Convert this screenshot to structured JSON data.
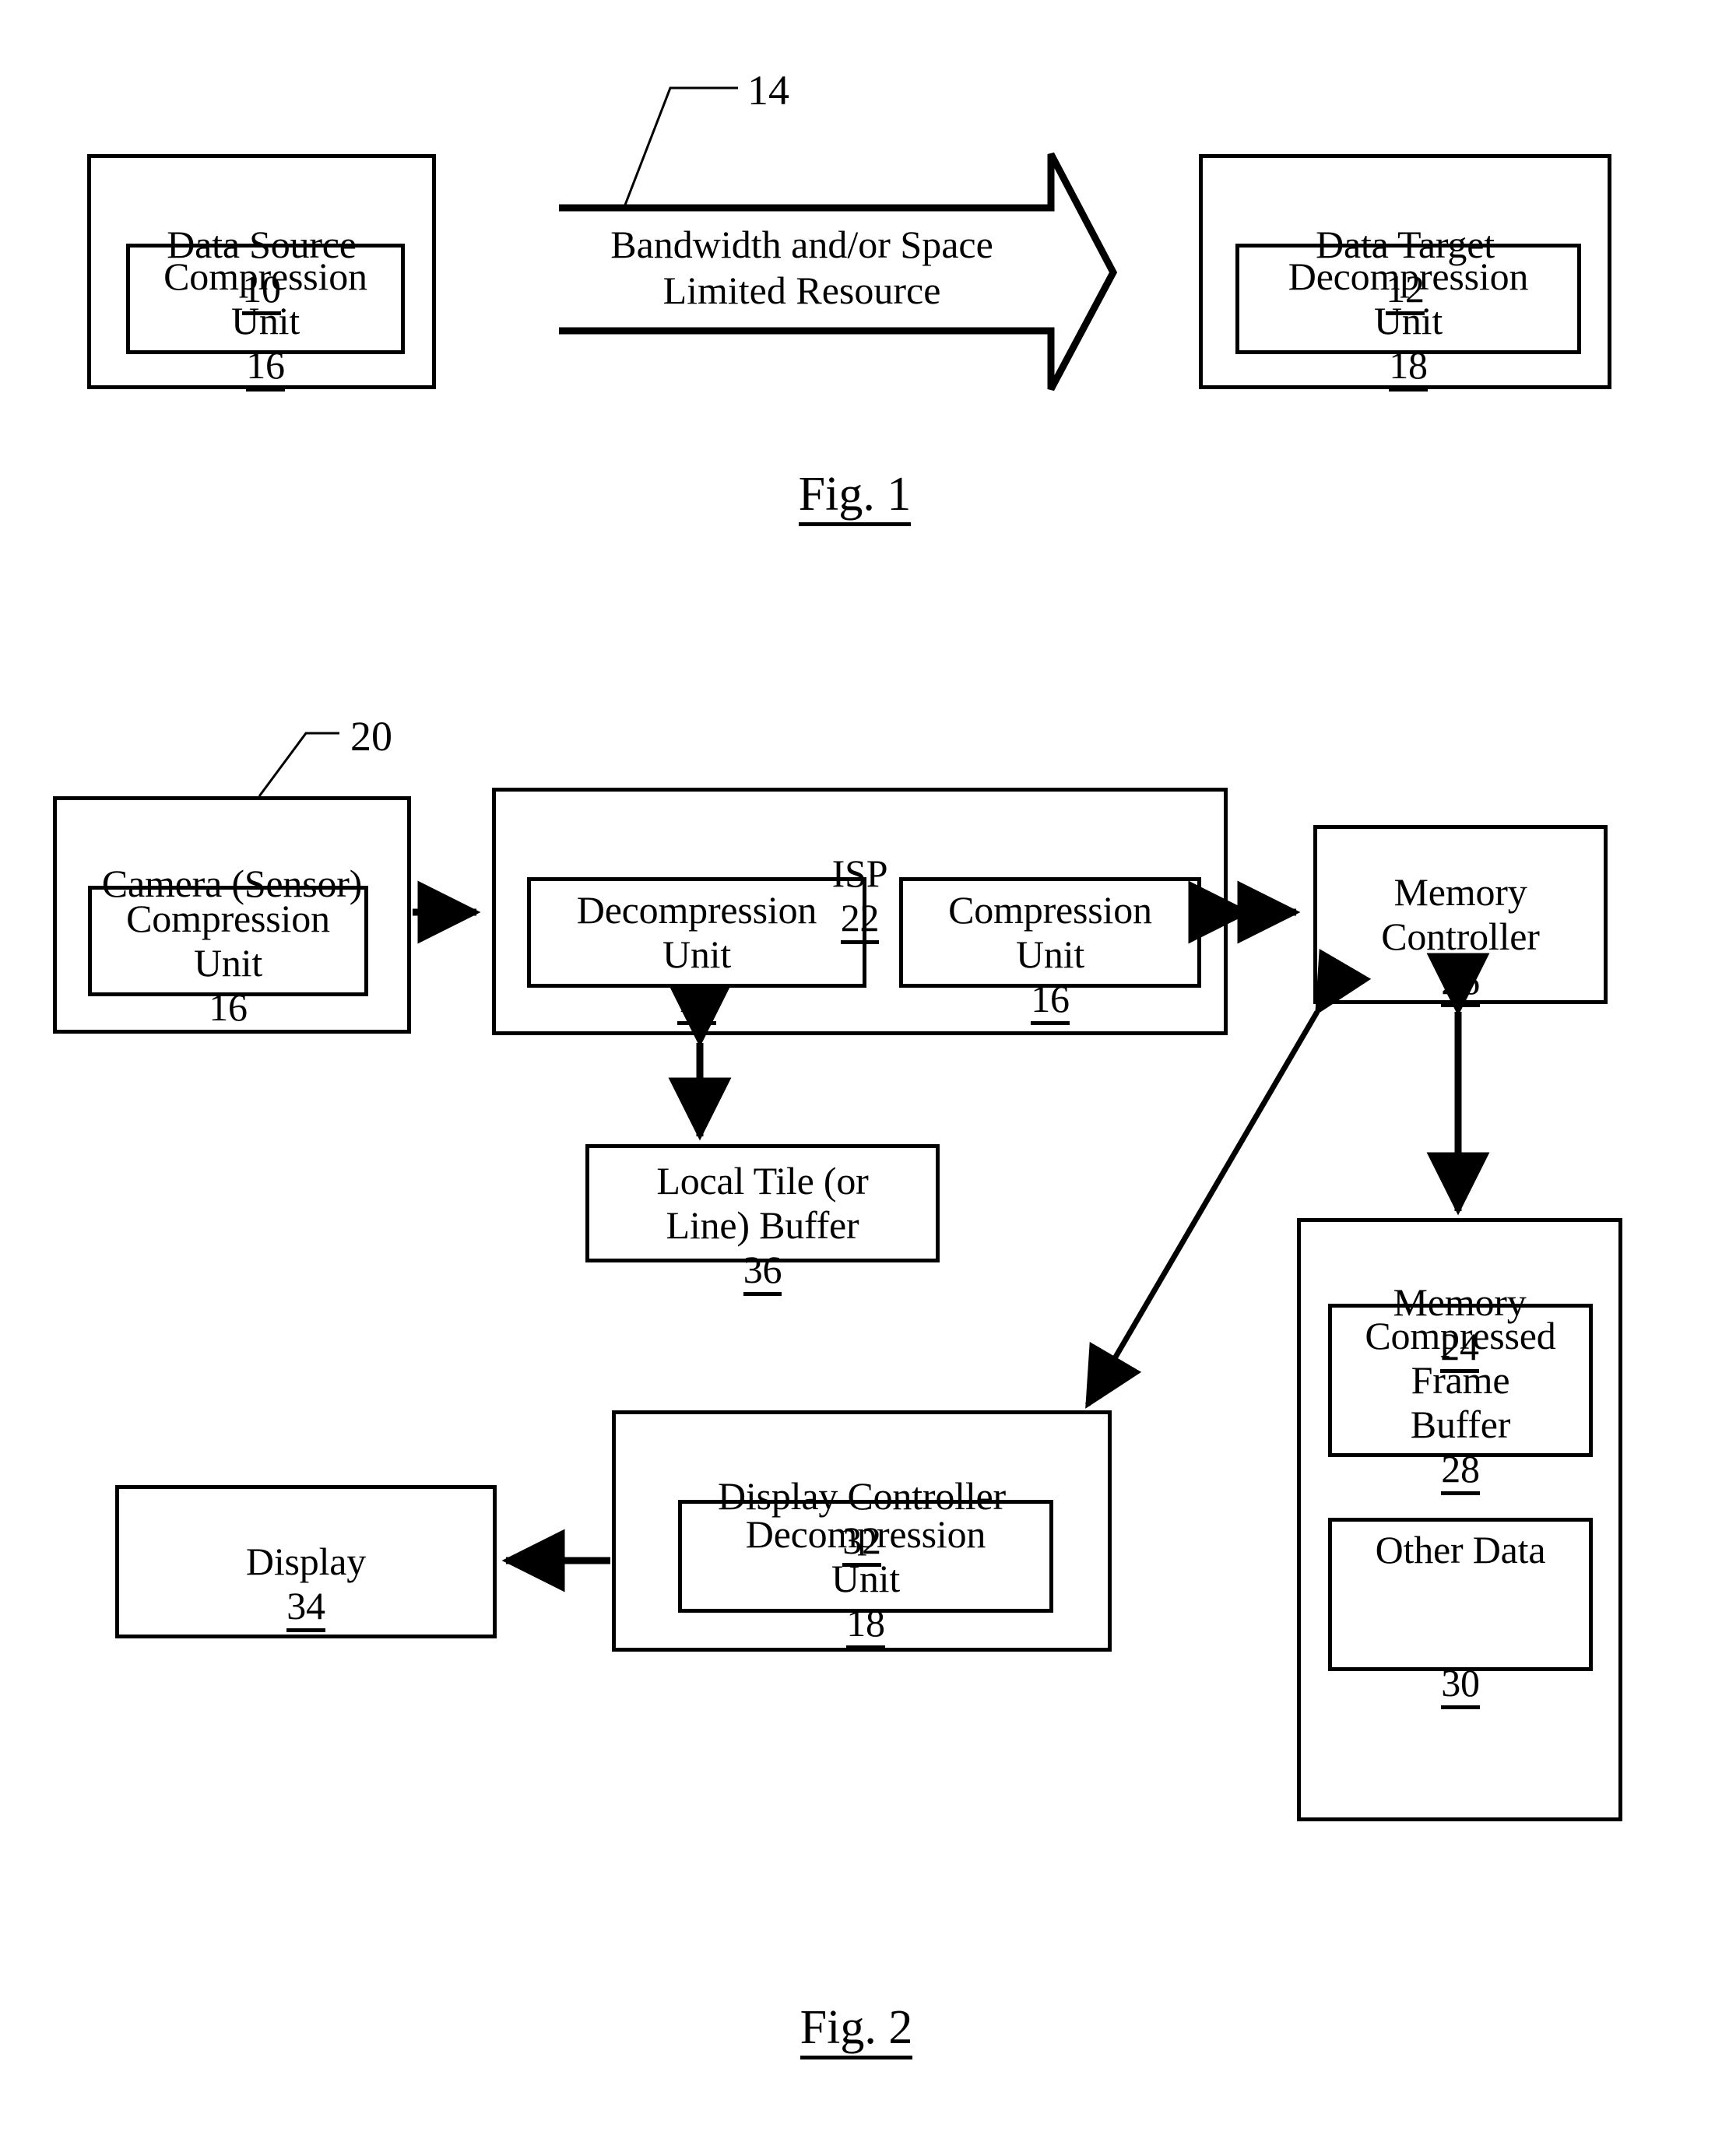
{
  "figure1": {
    "caption": "Fig. 1",
    "reference_number": "14",
    "data_source": {
      "title": "Data Source",
      "number": "10",
      "inner": {
        "title": "Compression\nUnit",
        "number": "16"
      }
    },
    "channel": {
      "label": "Bandwidth and/or Space\nLimited Resource",
      "number": "14"
    },
    "data_target": {
      "title": "Data Target",
      "number": "12",
      "inner": {
        "title": "Decompression\nUnit",
        "number": "18"
      }
    }
  },
  "figure2": {
    "caption": "Fig. 2",
    "reference_number": "20",
    "camera": {
      "title": "Camera (Sensor)",
      "number": "",
      "inner": {
        "title": "Compression\nUnit",
        "number": "16"
      }
    },
    "isp": {
      "title": "ISP",
      "number": "22",
      "decompression": {
        "title": "Decompression\nUnit",
        "number": "18"
      },
      "compression": {
        "title": "Compression\nUnit",
        "number": "16"
      }
    },
    "memory_controller": {
      "title": "Memory\nController",
      "number": "26"
    },
    "local_tile_buffer": {
      "title": "Local Tile (or\nLine) Buffer",
      "number": "36"
    },
    "memory": {
      "title": "Memory",
      "number": "24",
      "compressed_frame_buffer": {
        "title": "Compressed\nFrame\nBuffer",
        "number": "28"
      },
      "other_data": {
        "title": "Other Data",
        "number": "30"
      }
    },
    "display_controller": {
      "title": "Display Controller",
      "number": "32",
      "inner": {
        "title": "Decompression\nUnit",
        "number": "18"
      }
    },
    "display": {
      "title": "Display",
      "number": "34"
    }
  },
  "colors": {
    "ink": "#000000",
    "paper": "#ffffff"
  }
}
